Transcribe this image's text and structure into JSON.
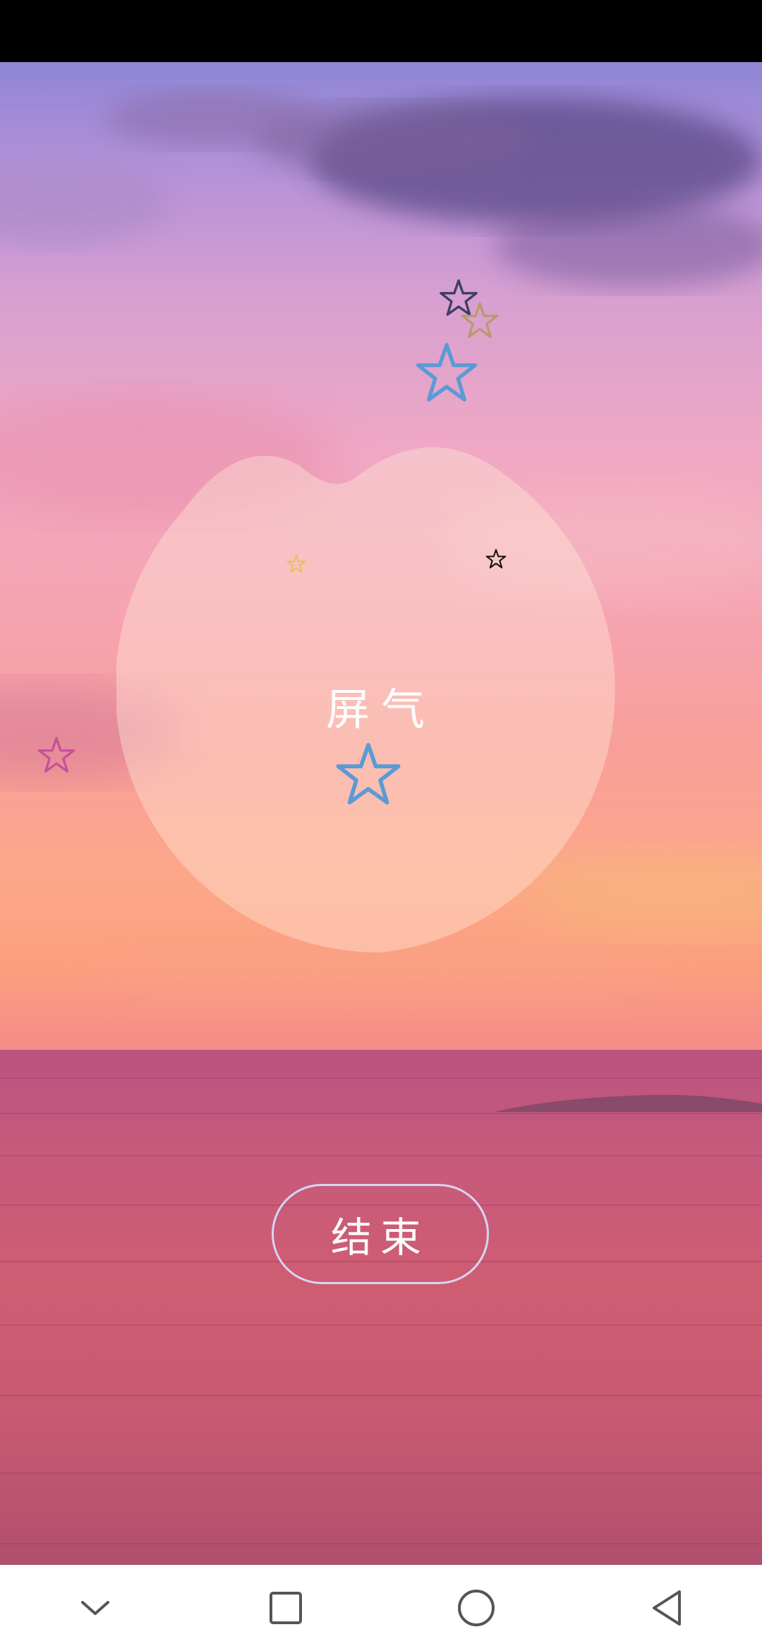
{
  "breathing": {
    "phase_label": "屏气",
    "end_button_label": "结束"
  },
  "colors": {
    "star_blue": "#5b9bd5",
    "star_dark": "#3d3d66",
    "star_gold": "#b89a6a",
    "star_pink": "#c8509a",
    "star_black": "#111111",
    "star_yellow": "#e8c060",
    "button_border": "#d6d6f4"
  },
  "nav": {
    "icons": [
      "chevron-down-icon",
      "square-icon",
      "circle-icon",
      "triangle-back-icon"
    ]
  }
}
